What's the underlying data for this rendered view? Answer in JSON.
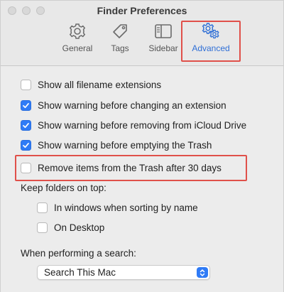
{
  "window": {
    "title": "Finder Preferences"
  },
  "toolbar": {
    "tabs": [
      {
        "label": "General",
        "icon": "gear-icon",
        "selected": false
      },
      {
        "label": "Tags",
        "icon": "tag-icon",
        "selected": false
      },
      {
        "label": "Sidebar",
        "icon": "sidebar-icon",
        "selected": false
      },
      {
        "label": "Advanced",
        "icon": "gears-icon",
        "selected": true
      }
    ]
  },
  "options": [
    {
      "label": "Show all filename extensions",
      "checked": false
    },
    {
      "label": "Show warning before changing an extension",
      "checked": true
    },
    {
      "label": "Show warning before removing from iCloud Drive",
      "checked": true
    },
    {
      "label": "Show warning before emptying the Trash",
      "checked": true
    },
    {
      "label": "Remove items from the Trash after 30 days",
      "checked": false
    }
  ],
  "keep_folders": {
    "heading": "Keep folders on top:",
    "items": [
      {
        "label": "In windows when sorting by name",
        "checked": false
      },
      {
        "label": "On Desktop",
        "checked": false
      }
    ]
  },
  "search": {
    "heading": "When performing a search:",
    "selected": "Search This Mac"
  },
  "colors": {
    "accent": "#2f7bf6",
    "highlight": "#e0504a"
  }
}
